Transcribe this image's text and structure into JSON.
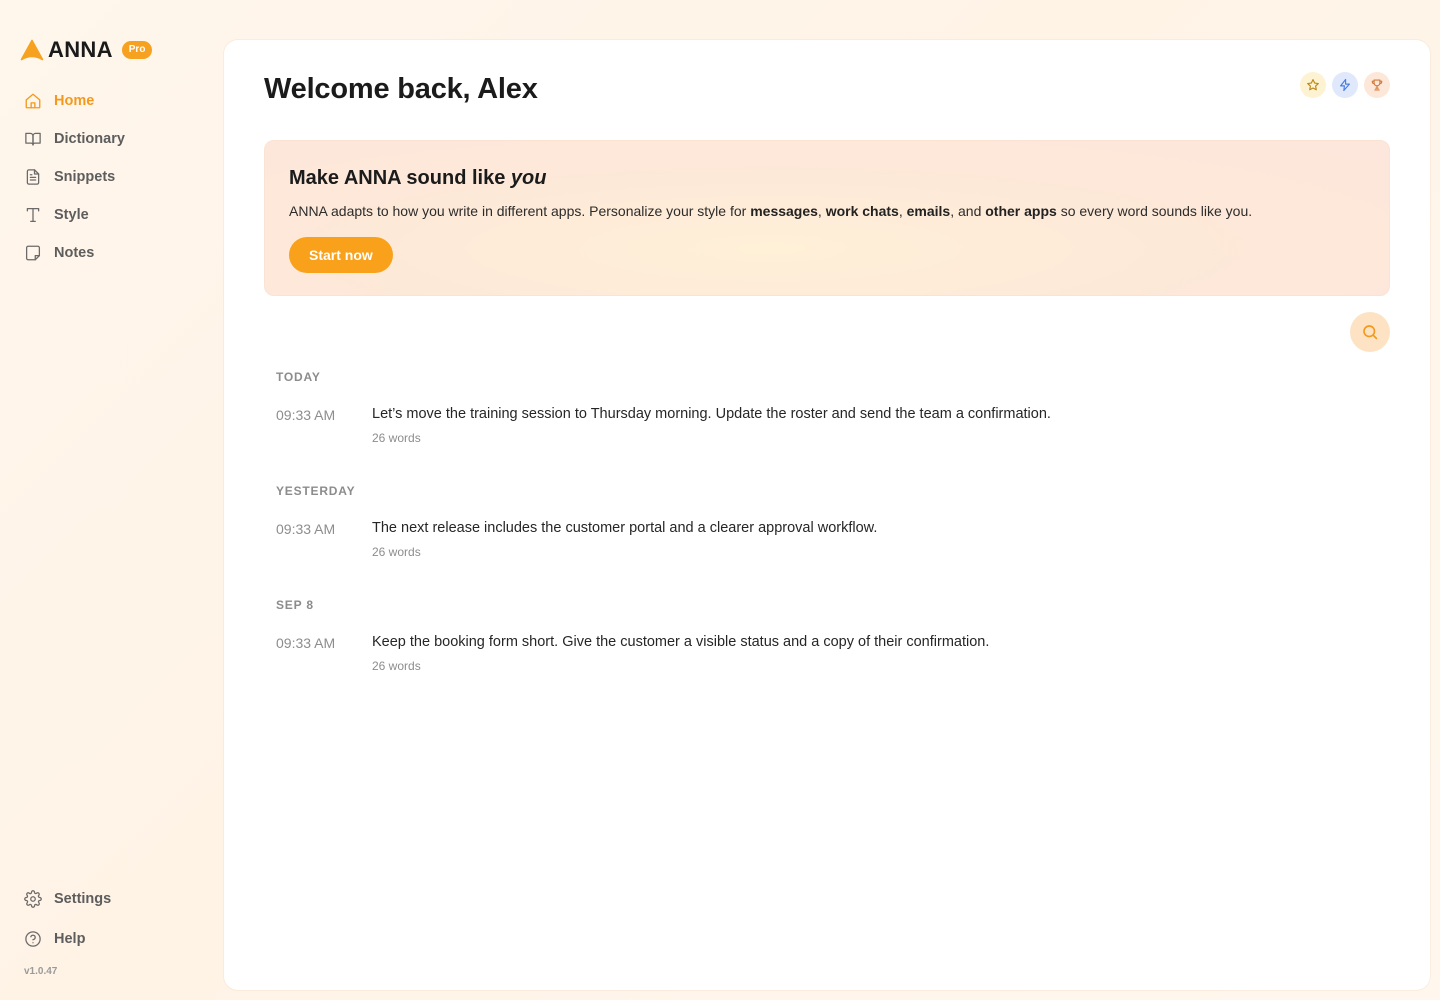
{
  "brand": {
    "name": "ANNA",
    "badge": "Pro",
    "accent": "#f7a120"
  },
  "sidebar": {
    "items": [
      {
        "label": "Home",
        "icon": "home-icon",
        "active": true
      },
      {
        "label": "Dictionary",
        "icon": "book-icon"
      },
      {
        "label": "Snippets",
        "icon": "document-icon"
      },
      {
        "label": "Style",
        "icon": "type-icon"
      },
      {
        "label": "Notes",
        "icon": "note-icon"
      }
    ],
    "bottom_items": [
      {
        "label": "Settings",
        "icon": "gear-icon"
      },
      {
        "label": "Help",
        "icon": "help-circle-icon"
      }
    ],
    "version": "v1.0.47"
  },
  "header": {
    "title": "Welcome back, Alex",
    "icons": [
      "star-icon",
      "lightning-icon",
      "trophy-icon"
    ]
  },
  "banner": {
    "title_prefix": "Make ANNA sound like ",
    "title_emphasis": "you",
    "text_parts": {
      "intro": "ANNA adapts to how you write in different apps. Personalize your style for ",
      "b1": "messages",
      "sep1": ", ",
      "b2": "work chats",
      "sep2": ", ",
      "b3": "emails",
      "sep3": ", and ",
      "b4": "other apps",
      "outro": " so every word sounds like you."
    },
    "button_label": "Start now"
  },
  "search": {
    "icon": "search-icon"
  },
  "feed": [
    {
      "day": "TODAY",
      "entries": [
        {
          "time": "09:33 AM",
          "text": "Let’s move the training session to Thursday morning. Update the roster and send the team a confirmation.",
          "words": "26 words"
        }
      ]
    },
    {
      "day": "YESTERDAY",
      "entries": [
        {
          "time": "09:33 AM",
          "text": "The next release includes the customer portal and a clearer approval workflow.",
          "words": "26 words"
        }
      ]
    },
    {
      "day": "SEP 8",
      "entries": [
        {
          "time": "09:33 AM",
          "text": "Keep the booking form short. Give the customer a visible status and a copy of their confirmation.",
          "words": "26 words"
        }
      ]
    }
  ]
}
